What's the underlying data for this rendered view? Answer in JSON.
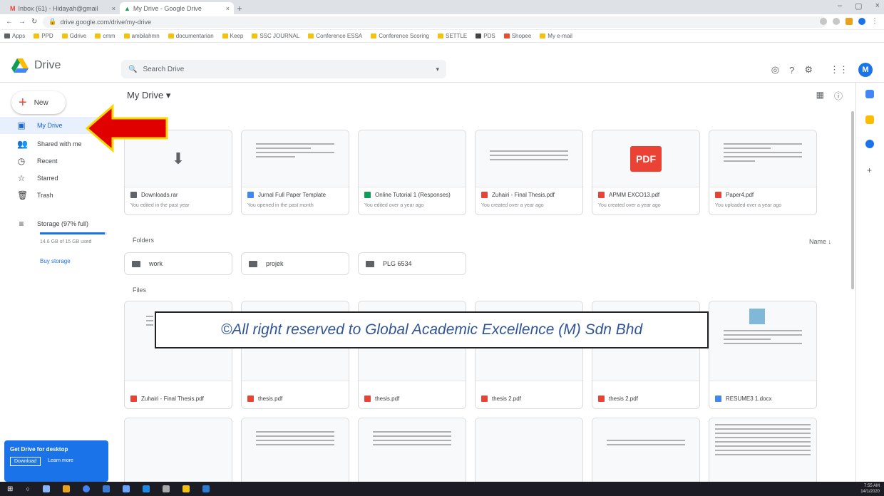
{
  "browser": {
    "tabs": [
      {
        "label": "Inbox (61) - Hidayah@gmail",
        "active": false
      },
      {
        "label": "My Drive - Google Drive",
        "active": true
      }
    ],
    "url": "drive.google.com/drive/my-drive",
    "bookmarks": [
      "Apps",
      "PPD",
      "Gdrive",
      "cmm",
      "ambilahmn",
      "documentarian",
      "Keep",
      "SSC JOURNAL",
      "Conference ESSA",
      "Conference Scoring",
      "SETTLE",
      "PDS",
      "Shopee",
      "My e-mail"
    ]
  },
  "header": {
    "app_name": "Drive",
    "search_placeholder": "Search Drive",
    "avatar_letter": "M"
  },
  "sidebar": {
    "new_label": "New",
    "items": [
      {
        "label": "My Drive",
        "icon": "drive-icon",
        "active": true
      },
      {
        "label": "Shared with me",
        "icon": "people-icon",
        "active": false
      },
      {
        "label": "Recent",
        "icon": "clock-icon",
        "active": false
      },
      {
        "label": "Starred",
        "icon": "star-icon",
        "active": false
      },
      {
        "label": "Trash",
        "icon": "trash-icon",
        "active": false
      }
    ],
    "storage_label": "Storage (97% full)",
    "storage_used_fraction": 0.97,
    "storage_detail": "14.6 GB of 15 GB used",
    "buy_storage": "Buy storage",
    "promo": {
      "title": "Get Drive for desktop",
      "download": "Download",
      "learn": "Learn more"
    }
  },
  "main": {
    "title": "My Drive",
    "quick_access": [
      {
        "name": "Downloads.rar",
        "sub": "You edited in the past year",
        "type": "zip"
      },
      {
        "name": "Jurnal Full Paper Template",
        "sub": "You opened in the past month",
        "type": "doc"
      },
      {
        "name": "Online Tutorial 1 (Responses)",
        "sub": "You edited over a year ago",
        "type": "sheet"
      },
      {
        "name": "Zuhairi - Final Thesis.pdf",
        "sub": "You created over a year ago",
        "type": "pdf"
      },
      {
        "name": "APMM EXCO13.pdf",
        "sub": "You created over a year ago",
        "type": "pdf"
      },
      {
        "name": "Paper4.pdf",
        "sub": "You uploaded over a year ago",
        "type": "pdf"
      }
    ],
    "folders_label": "Folders",
    "sort_label": "Name",
    "folders": [
      "work",
      "projek",
      "PLG 6534"
    ],
    "files_label": "Files",
    "files": [
      {
        "name": "Zuhairi - Final Thesis.pdf",
        "type": "pdf"
      },
      {
        "name": "thesis.pdf",
        "type": "pdf"
      },
      {
        "name": "thesis.pdf",
        "type": "pdf"
      },
      {
        "name": "thesis 2.pdf",
        "type": "pdf"
      },
      {
        "name": "thesis 2.pdf",
        "type": "pdf"
      },
      {
        "name": "RESUME3 1.docx",
        "type": "doc"
      }
    ]
  },
  "overlay": {
    "watermark": "©All right reserved to Global Academic Excellence (M) Sdn Bhd"
  },
  "taskbar": {
    "time": "7:55 AM",
    "date": "14/1/2020"
  },
  "colors": {
    "accent": "#1a73e8",
    "pdf": "#ea4335",
    "sheet": "#0f9d58",
    "arrow": "#e00000",
    "arrow_outline": "#f5d800"
  }
}
